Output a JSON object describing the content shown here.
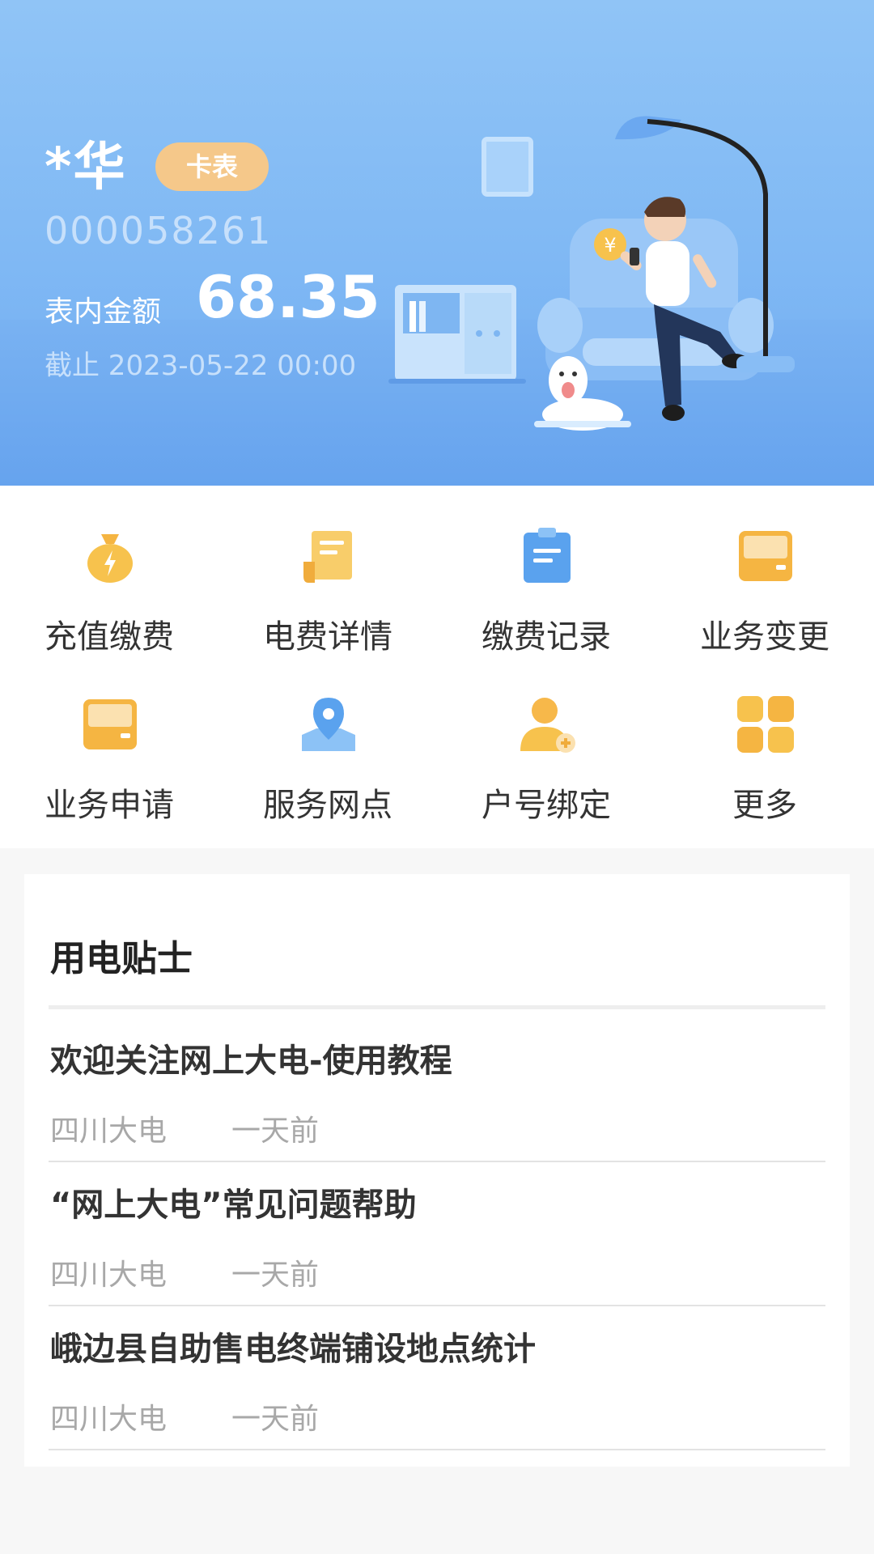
{
  "account": {
    "name": "*华",
    "meter_type": "卡表",
    "number": "000058261",
    "balance_label": "表内金额",
    "balance": "68.35",
    "as_of": "截止 2023-05-22 00:00"
  },
  "services": [
    {
      "label": "充值缴费",
      "icon": "money-bag-icon"
    },
    {
      "label": "电费详情",
      "icon": "bill-scroll-icon"
    },
    {
      "label": "缴费记录",
      "icon": "clipboard-icon"
    },
    {
      "label": "业务变更",
      "icon": "card-reader-icon"
    },
    {
      "label": "业务申请",
      "icon": "card-reader-icon"
    },
    {
      "label": "服务网点",
      "icon": "map-pin-icon"
    },
    {
      "label": "户号绑定",
      "icon": "user-add-icon"
    },
    {
      "label": "更多",
      "icon": "grid-icon"
    }
  ],
  "tips": {
    "title": "用电贴士",
    "items": [
      {
        "title": "欢迎关注网上大电-使用教程",
        "source": "四川大电",
        "time": "一天前"
      },
      {
        "title": "“网上大电”常见问题帮助",
        "source": "四川大电",
        "time": "一天前"
      },
      {
        "title": "峨边县自助售电终端铺设地点统计",
        "source": "四川大电",
        "time": "一天前"
      }
    ]
  },
  "colors": {
    "hero_blue": "#7fb8f4",
    "badge_orange": "#f5c88a",
    "icon_yellow": "#f7b84a",
    "icon_blue": "#5aa2ee"
  }
}
